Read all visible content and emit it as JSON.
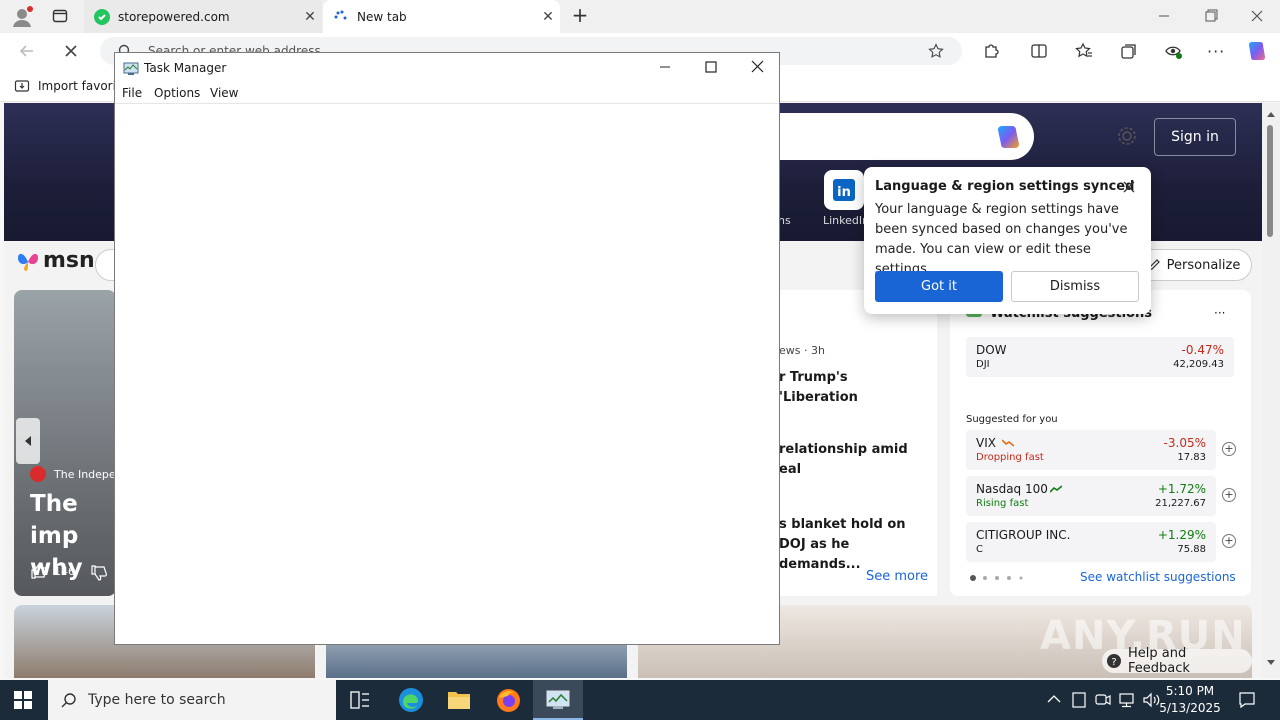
{
  "browser": {
    "tabs": [
      {
        "title": "storepowered.com"
      },
      {
        "title": "New tab"
      }
    ],
    "address_placeholder": "Search or enter web address",
    "favorites_bar": {
      "import_label": "Import favorite"
    }
  },
  "msn": {
    "logo_text": "msn",
    "sign_in": "Sign in",
    "personalize": "Personalize",
    "linkedin_label": "LinkedIn",
    "apps_label_fragment": "ns",
    "left_card": {
      "source": "The Indepe",
      "headline": "The imp why",
      "likes": "146"
    },
    "news": {
      "meta": "ews · 3h",
      "items": [
        "r Trump's 'Liberation",
        "relationship amid eal",
        "s blanket hold on DOJ as he demands..."
      ],
      "see_more": "See more"
    },
    "watchlist": {
      "title": "Watchlist suggestions",
      "more": "···",
      "featured": {
        "name": "DOW",
        "symbol": "DJI",
        "change": "-0.47%",
        "price": "42,209.43"
      },
      "suggested_label": "Suggested for you",
      "suggested": [
        {
          "name": "VIX",
          "sub": "Dropping fast",
          "change": "-3.05%",
          "price": "17.83",
          "trend": "neg"
        },
        {
          "name": "Nasdaq 100",
          "sub": "Rising fast",
          "change": "+1.72%",
          "price": "21,227.67",
          "trend": "pos"
        },
        {
          "name": "CITIGROUP INC.",
          "sub": "C",
          "change": "+1.29%",
          "price": "75.88",
          "trend": "pos"
        }
      ],
      "see_suggestions": "See watchlist suggestions"
    },
    "help_feedback": "Help and Feedback",
    "watermark": "ANY.RUN"
  },
  "popup": {
    "title": "Language & region settings synced",
    "body": "Your language & region settings have been synced based on changes you've made. You can view or edit these settings.",
    "got_it": "Got it",
    "dismiss": "Dismiss"
  },
  "task_manager": {
    "title": "Task Manager",
    "menu": [
      "File",
      "Options",
      "View"
    ]
  },
  "taskbar": {
    "search_placeholder": "Type here to search",
    "time": "5:10 PM",
    "date": "5/13/2025"
  },
  "colors": {
    "accent_blue": "#1a65d6",
    "negative": "#c42b1c",
    "positive": "#107c10",
    "taskbar": "#1c2b3a"
  }
}
